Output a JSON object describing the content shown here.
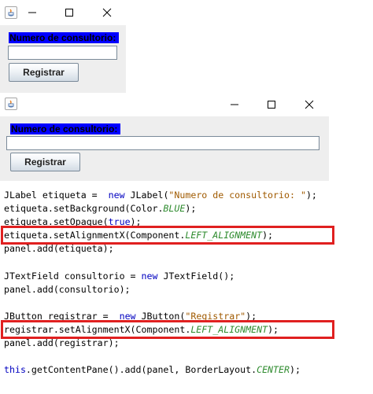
{
  "window1": {
    "label_text": "Numero de consultorio:",
    "field_value": "",
    "button_label": "Registrar",
    "controls": [
      "minimize-icon",
      "maximize-icon",
      "close-icon"
    ]
  },
  "window2": {
    "label_text": "Numero de consultorio:",
    "field_value": "",
    "button_label": "Registrar",
    "controls": [
      "minimize-icon",
      "maximize-icon",
      "close-icon"
    ]
  },
  "code": {
    "lines": [
      [
        {
          "t": "JLabel etiqueta =  "
        },
        {
          "t": "new",
          "c": "kw"
        },
        {
          "t": " JLabel("
        },
        {
          "t": "\"Numero de consultorio: \"",
          "c": "str"
        },
        {
          "t": ");"
        }
      ],
      [
        {
          "t": "etiqueta.setBackground(Color."
        },
        {
          "t": "BLUE",
          "c": "cst"
        },
        {
          "t": ");"
        }
      ],
      [
        {
          "t": "etiqueta.setOpaque("
        },
        {
          "t": "true",
          "c": "kw"
        },
        {
          "t": ");"
        }
      ],
      [
        {
          "t": "etiqueta.setAlignmentX(Component."
        },
        {
          "t": "LEFT_ALIGNMENT",
          "c": "cst"
        },
        {
          "t": ");"
        }
      ],
      [
        {
          "t": "panel.add(etiqueta);"
        }
      ],
      [],
      [
        {
          "t": "JTextField consultorio = "
        },
        {
          "t": "new",
          "c": "kw"
        },
        {
          "t": " JTextField();"
        }
      ],
      [
        {
          "t": "panel.add(consultorio);"
        }
      ],
      [],
      [
        {
          "t": "JButton registrar =  "
        },
        {
          "t": "new",
          "c": "kw"
        },
        {
          "t": " JButton("
        },
        {
          "t": "\"Registrar\"",
          "c": "str"
        },
        {
          "t": ");"
        }
      ],
      [
        {
          "t": "registrar.setAlignmentX(Component."
        },
        {
          "t": "LEFT_ALIGNMENT",
          "c": "cst"
        },
        {
          "t": ");"
        }
      ],
      [
        {
          "t": "panel.add(registrar);"
        }
      ],
      [],
      [
        {
          "t": "this",
          "c": "kw"
        },
        {
          "t": ".getContentPane().add(panel, BorderLayout."
        },
        {
          "t": "CENTER",
          "c": "cst"
        },
        {
          "t": ");"
        }
      ]
    ],
    "highlighted_lines": [
      3,
      10
    ],
    "colors": {
      "keyword": "#0000c0",
      "string": "#a05a00",
      "constant": "#2e8b2e",
      "highlight_border": "#e02020"
    }
  },
  "colors": {
    "label_background": "#0000ff",
    "panel_background": "#eeeeee"
  }
}
